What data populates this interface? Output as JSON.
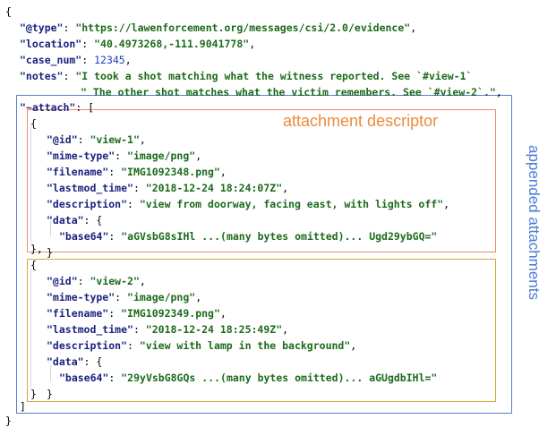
{
  "lines": [
    [
      [
        "p",
        "{"
      ]
    ],
    [
      [
        "k",
        "\"@type\""
      ],
      [
        "p",
        ": "
      ],
      [
        "s",
        "\"https://lawenforcement.org/messages/csi/2.0/evidence\""
      ],
      [
        "p",
        ","
      ]
    ],
    [
      [
        "k",
        "\"location\""
      ],
      [
        "p",
        ": "
      ],
      [
        "s",
        "\"40.4973268,-111.9041778\""
      ],
      [
        "p",
        ","
      ]
    ],
    [
      [
        "k",
        "\"case_num\""
      ],
      [
        "p",
        ": "
      ],
      [
        "n",
        "12345"
      ],
      [
        "p",
        ","
      ]
    ],
    [
      [
        "k",
        "\"notes\""
      ],
      [
        "p",
        ": "
      ],
      [
        "s",
        "\"I took a shot matching what the witness reported. See `#view-1`"
      ]
    ],
    [
      [
        "s",
        "\" The other shot matches what the victim remembers. See `#view-2`.\""
      ],
      [
        "p",
        ","
      ]
    ],
    [
      [
        "k",
        "\"~attach\""
      ],
      [
        "p",
        ": ["
      ]
    ],
    [
      [
        "p",
        "{"
      ]
    ],
    [
      [
        "k",
        "\"@id\""
      ],
      [
        "p",
        ": "
      ],
      [
        "s",
        "\"view-1\""
      ],
      [
        "p",
        ","
      ]
    ],
    [
      [
        "k",
        "\"mime-type\""
      ],
      [
        "p",
        ": "
      ],
      [
        "s",
        "\"image/png\""
      ],
      [
        "p",
        ","
      ]
    ],
    [
      [
        "k",
        "\"filename\""
      ],
      [
        "p",
        ": "
      ],
      [
        "s",
        "\"IMG1092348.png\""
      ],
      [
        "p",
        ","
      ]
    ],
    [
      [
        "k",
        "\"lastmod_time\""
      ],
      [
        "p",
        ": "
      ],
      [
        "s",
        "\"2018-12-24 18:24:07Z\""
      ],
      [
        "p",
        ","
      ]
    ],
    [
      [
        "k",
        "\"description\""
      ],
      [
        "p",
        ": "
      ],
      [
        "s",
        "\"view from doorway, facing east, with lights off\""
      ],
      [
        "p",
        ","
      ]
    ],
    [
      [
        "k",
        "\"data\""
      ],
      [
        "p",
        ": {"
      ]
    ],
    [
      [
        "k",
        "\"base64\""
      ],
      [
        "p",
        ": "
      ],
      [
        "s",
        "\"aGVsbG8sIHl ...(many bytes omitted)... Ugd29ybGQ=\""
      ]
    ],
    [
      [
        "p",
        "}"
      ]
    ],
    [
      [
        "p",
        "},"
      ]
    ],
    [
      [
        "p",
        "{"
      ]
    ],
    [
      [
        "k",
        "\"@id\""
      ],
      [
        "p",
        ": "
      ],
      [
        "s",
        "\"view-2\""
      ],
      [
        "p",
        ","
      ]
    ],
    [
      [
        "k",
        "\"mime-type\""
      ],
      [
        "p",
        ": "
      ],
      [
        "s",
        "\"image/png\""
      ],
      [
        "p",
        ","
      ]
    ],
    [
      [
        "k",
        "\"filename\""
      ],
      [
        "p",
        ": "
      ],
      [
        "s",
        "\"IMG1092349.png\""
      ],
      [
        "p",
        ","
      ]
    ],
    [
      [
        "k",
        "\"lastmod_time\""
      ],
      [
        "p",
        ": "
      ],
      [
        "s",
        "\"2018-12-24 18:25:49Z\""
      ],
      [
        "p",
        ","
      ]
    ],
    [
      [
        "k",
        "\"description\""
      ],
      [
        "p",
        ": "
      ],
      [
        "s",
        "\"view with lamp in the background\""
      ],
      [
        "p",
        ","
      ]
    ],
    [
      [
        "k",
        "\"data\""
      ],
      [
        "p",
        ": {"
      ]
    ],
    [
      [
        "k",
        "\"base64\""
      ],
      [
        "p",
        ": "
      ],
      [
        "s",
        "\"29yVsbG8GQs ...(many bytes omitted)... aGUgdbIHl=\""
      ]
    ],
    [
      [
        "p",
        "}"
      ]
    ],
    [
      [
        "p",
        "}"
      ]
    ],
    [
      [
        "p",
        "]"
      ]
    ],
    [
      [
        "p",
        "}"
      ]
    ]
  ],
  "annotations": {
    "descriptor": "attachment descriptor",
    "appended": "appended attachments"
  },
  "colors": {
    "key": "#1a237e",
    "string": "#1b6b1b",
    "number": "#1f3fbf",
    "outer_box": "#5b7fd6",
    "descriptor_box_1": "#f08a6e",
    "descriptor_box_2": "#d9a441",
    "descriptor_label": "#ee8a3a",
    "appended_label": "#4a7bd6"
  }
}
